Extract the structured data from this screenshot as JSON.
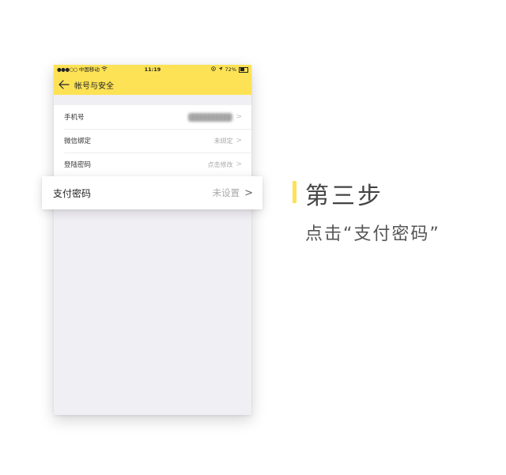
{
  "status_bar": {
    "carrier": "中国移动",
    "time": "11:19",
    "battery": "72%",
    "battery_level": 0.72
  },
  "nav": {
    "title": "帐号与安全"
  },
  "settings_rows": [
    {
      "label": "手机号",
      "value": ""
    },
    {
      "label": "微信绑定",
      "value": "未绑定"
    },
    {
      "label": "登陆密码",
      "value": "点击修改"
    }
  ],
  "highlight_row": {
    "label": "支付密码",
    "value": "未设置"
  },
  "step": {
    "title": "第三步",
    "subtitle": "点击“支付密码”"
  },
  "colors": {
    "accent_yellow": "#fde255",
    "background": "#f0eff4"
  },
  "icons": {
    "back": "back-arrow-icon",
    "chevron": "chevron-right-icon",
    "wifi": "wifi-icon",
    "location": "location-arrow-icon",
    "lock": "rotation-lock-icon",
    "battery": "battery-icon"
  }
}
